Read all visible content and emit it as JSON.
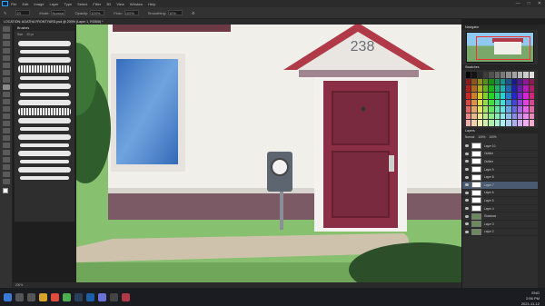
{
  "app": {
    "menu": [
      "File",
      "Edit",
      "Image",
      "Layer",
      "Type",
      "Select",
      "Filter",
      "3D",
      "View",
      "Window",
      "Help"
    ],
    "document_title": "LOCATION: AGATHA FRONTYARD.psd @ 200% (Layer 1, RGB/8) *",
    "zoom": "200%",
    "status": "200%"
  },
  "options_bar": {
    "brush_size": "20",
    "mode_label": "Mode:",
    "mode_value": "Normal",
    "opacity_label": "Opacity:",
    "opacity_value": "100%",
    "flow_label": "Flow:",
    "flow_value": "100%",
    "smoothing_label": "Smoothing:",
    "smoothing_value": "10%"
  },
  "brushes_panel": {
    "title": "Brushes",
    "size_label": "Size",
    "size_value": "20 px"
  },
  "canvas": {
    "house_number": "238"
  },
  "right_panels": {
    "navigator_title": "Navigator",
    "swatches_title": "Swatches",
    "layers_title": "Layers",
    "blend_mode": "Normal",
    "opacity": "100%",
    "fill": "100%",
    "layers": [
      {
        "name": "Layer 10",
        "selected": false
      },
      {
        "name": "Outline",
        "selected": false
      },
      {
        "name": "Outline",
        "selected": false
      },
      {
        "name": "Layer 9",
        "selected": false
      },
      {
        "name": "Layer 8",
        "selected": false
      },
      {
        "name": "Layer 7",
        "selected": true
      },
      {
        "name": "Layer 6",
        "selected": false
      },
      {
        "name": "Layer 5",
        "selected": false
      },
      {
        "name": "Layer 4",
        "selected": false
      },
      {
        "name": "Shadows",
        "selected": false
      },
      {
        "name": "Layer 3",
        "selected": false
      },
      {
        "name": "Layer 2",
        "selected": false
      }
    ]
  },
  "taskbar": {
    "time": "2:56 PM",
    "date": "2021-11-12",
    "lang": "ENG"
  },
  "colors": {
    "wall": "#f1efea",
    "roof": "#b03a47",
    "door": "#8a2f45",
    "grass": "#87c06f",
    "ui_dark": "#2e2e2e"
  }
}
